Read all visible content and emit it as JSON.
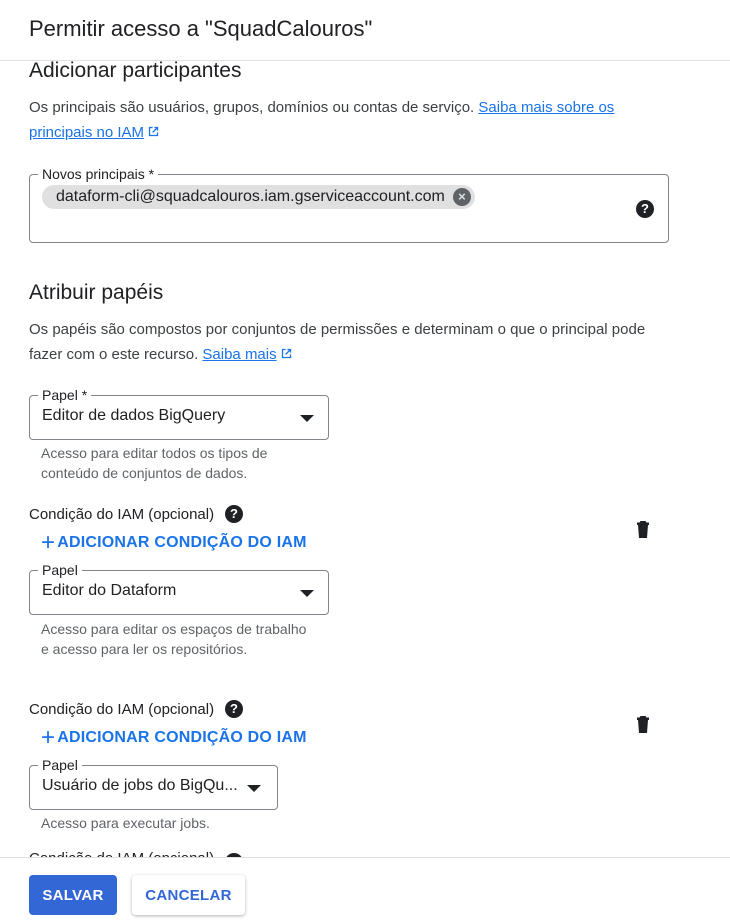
{
  "dialog": {
    "title": "Permitir acesso a \"SquadCalouros\""
  },
  "add_members": {
    "heading": "Adicionar participantes",
    "description": "Os principais são usuários, grupos, domínios ou contas de serviço.",
    "learn_more_link": "Saiba mais sobre os principais no IAM",
    "principals_field": {
      "label": "Novos principais *",
      "chips": [
        "dataform-cli@squadcalouros.iam.gserviceaccount.com"
      ]
    }
  },
  "assign_roles": {
    "heading": "Atribuir papéis",
    "description": "Os papéis são compostos por conjuntos de permissões e determinam o que o principal pode fazer com o este recurso.",
    "learn_more_link": "Saiba mais",
    "roles": [
      {
        "label": "Papel *",
        "value": "Editor de dados BigQuery",
        "hint": "Acesso para editar todos os tipos de conteúdo de conjuntos de dados."
      },
      {
        "label": "Papel",
        "value": "Editor do Dataform",
        "hint": "Acesso para editar os espaços de trabalho e acesso para ler os repositórios."
      },
      {
        "label": "Papel",
        "value": "Usuário de jobs do BigQu...",
        "hint": "Acesso para executar jobs."
      }
    ],
    "condition_label": "Condição do IAM (opcional)",
    "add_condition": "ADICIONAR CONDIÇÃO DO IAM"
  },
  "footer": {
    "save": "SALVAR",
    "cancel": "CANCELAR"
  },
  "colors": {
    "accent": "#1a73e8",
    "primary_button": "#3367d6",
    "chip": "#e0e0e0"
  }
}
